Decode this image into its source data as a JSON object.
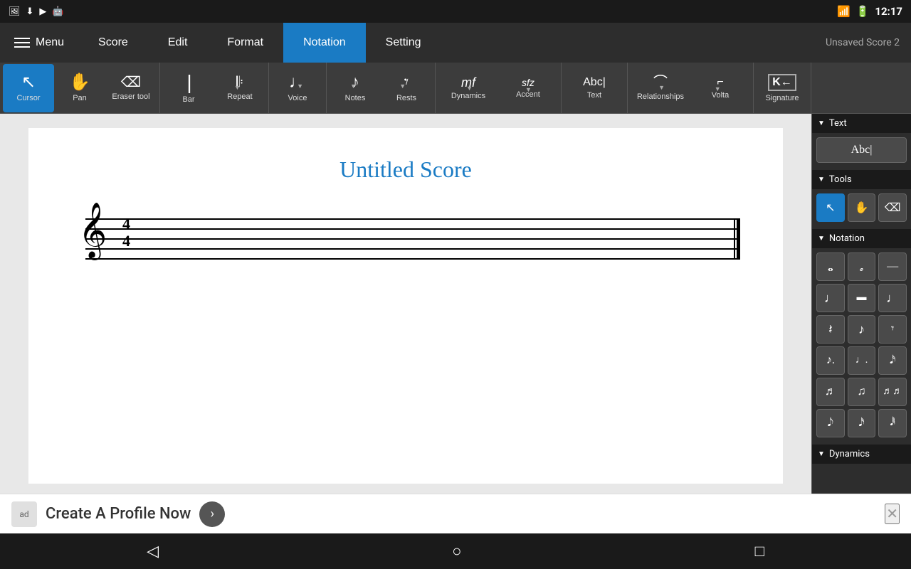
{
  "statusBar": {
    "time": "12:17",
    "icons": [
      "gallery",
      "download",
      "play",
      "android"
    ]
  },
  "menuBar": {
    "menu_label": "Menu",
    "unsaved_label": "Unsaved Score 2",
    "tabs": [
      {
        "id": "score",
        "label": "Score",
        "active": false
      },
      {
        "id": "edit",
        "label": "Edit",
        "active": false
      },
      {
        "id": "format",
        "label": "Format",
        "active": false
      },
      {
        "id": "notation",
        "label": "Notation",
        "active": true
      },
      {
        "id": "setting",
        "label": "Setting",
        "active": false
      }
    ]
  },
  "toolbar": {
    "items": [
      {
        "id": "cursor",
        "label": "Cursor",
        "icon": "↖",
        "active": true,
        "dropdown": false
      },
      {
        "id": "pan",
        "label": "Pan",
        "icon": "✋",
        "active": false,
        "dropdown": false
      },
      {
        "id": "eraser",
        "label": "Eraser tool",
        "icon": "⌫",
        "active": false,
        "dropdown": false
      },
      {
        "id": "bar",
        "label": "Bar",
        "icon": "𝄀",
        "active": false,
        "dropdown": false
      },
      {
        "id": "repeat",
        "label": "Repeat",
        "icon": "𝄆",
        "active": false,
        "dropdown": true
      },
      {
        "id": "voice",
        "label": "Voice",
        "icon": "♩",
        "active": false,
        "dropdown": true
      },
      {
        "id": "notes",
        "label": "Notes",
        "icon": "♪",
        "active": false,
        "dropdown": true
      },
      {
        "id": "rests",
        "label": "Rests",
        "icon": "𝄾",
        "active": false,
        "dropdown": true
      },
      {
        "id": "dynamics",
        "label": "Dynamics",
        "icon": "mf",
        "active": false,
        "dropdown": true
      },
      {
        "id": "accent",
        "label": "Accent",
        "icon": "sfz",
        "active": false,
        "dropdown": true
      },
      {
        "id": "text",
        "label": "Text",
        "icon": "Abc|",
        "active": false,
        "dropdown": false
      },
      {
        "id": "relationships",
        "label": "Relationships",
        "icon": "𝄠",
        "active": false,
        "dropdown": true
      },
      {
        "id": "volta",
        "label": "Volta",
        "icon": "𝄏",
        "active": false,
        "dropdown": true
      },
      {
        "id": "signature",
        "label": "Signature",
        "icon": "#",
        "active": false,
        "dropdown": false
      }
    ]
  },
  "score": {
    "title": "Untitled Score",
    "timeSignature": {
      "numerator": "4",
      "denominator": "4"
    }
  },
  "rightPanel": {
    "sections": [
      {
        "id": "text",
        "label": "Text",
        "items": [
          {
            "id": "abc",
            "icon": "Abc|",
            "active": false
          }
        ]
      },
      {
        "id": "tools",
        "label": "Tools",
        "items": [
          {
            "id": "cursor-tool",
            "icon": "↖",
            "active": true
          },
          {
            "id": "pan-tool",
            "icon": "✋",
            "active": false
          },
          {
            "id": "eraser-tool",
            "icon": "⌫",
            "active": false
          }
        ]
      },
      {
        "id": "notation",
        "label": "Notation",
        "grid": [
          {
            "id": "whole-note",
            "icon": "𝅝",
            "active": false
          },
          {
            "id": "half-note",
            "icon": "𝅗𝅥",
            "active": false
          },
          {
            "id": "whole-rest",
            "icon": "𝄻",
            "active": false
          },
          {
            "id": "quarter-note-stem",
            "icon": "♩",
            "active": false
          },
          {
            "id": "half-rest",
            "icon": "𝄼",
            "active": false
          },
          {
            "id": "quarter-note",
            "icon": "♩",
            "active": false
          },
          {
            "id": "eighth-rest",
            "icon": "𝄽",
            "active": false
          },
          {
            "id": "eighth-note",
            "icon": "♪",
            "active": false
          },
          {
            "id": "sixteenth-rest",
            "icon": "𝄾",
            "active": false
          },
          {
            "id": "dotted-eighth",
            "icon": "♪.",
            "active": false
          },
          {
            "id": "dotted-quarter",
            "icon": "♩.",
            "active": false
          },
          {
            "id": "thirty-second",
            "icon": "𝅘𝅥𝅯",
            "active": false
          },
          {
            "id": "sixty-fourth1",
            "icon": "♬",
            "active": false
          },
          {
            "id": "sixty-fourth2",
            "icon": "♫",
            "active": false
          },
          {
            "id": "sixty-fourth3",
            "icon": "♬♬",
            "active": false
          },
          {
            "id": "note-a1",
            "icon": "𝅘𝅥𝅮",
            "active": false
          },
          {
            "id": "note-a2",
            "icon": "𝅘𝅥𝅯",
            "active": false
          },
          {
            "id": "note-a3",
            "icon": "𝅘𝅥𝅱",
            "active": false
          }
        ]
      },
      {
        "id": "dynamics",
        "label": "Dynamics",
        "items": []
      }
    ]
  },
  "adBanner": {
    "text": "Create A Profile Now",
    "icon_label": "ad",
    "arrow": "›",
    "close": "✕"
  },
  "navBar": {
    "back": "◁",
    "home": "○",
    "recent": "□"
  }
}
